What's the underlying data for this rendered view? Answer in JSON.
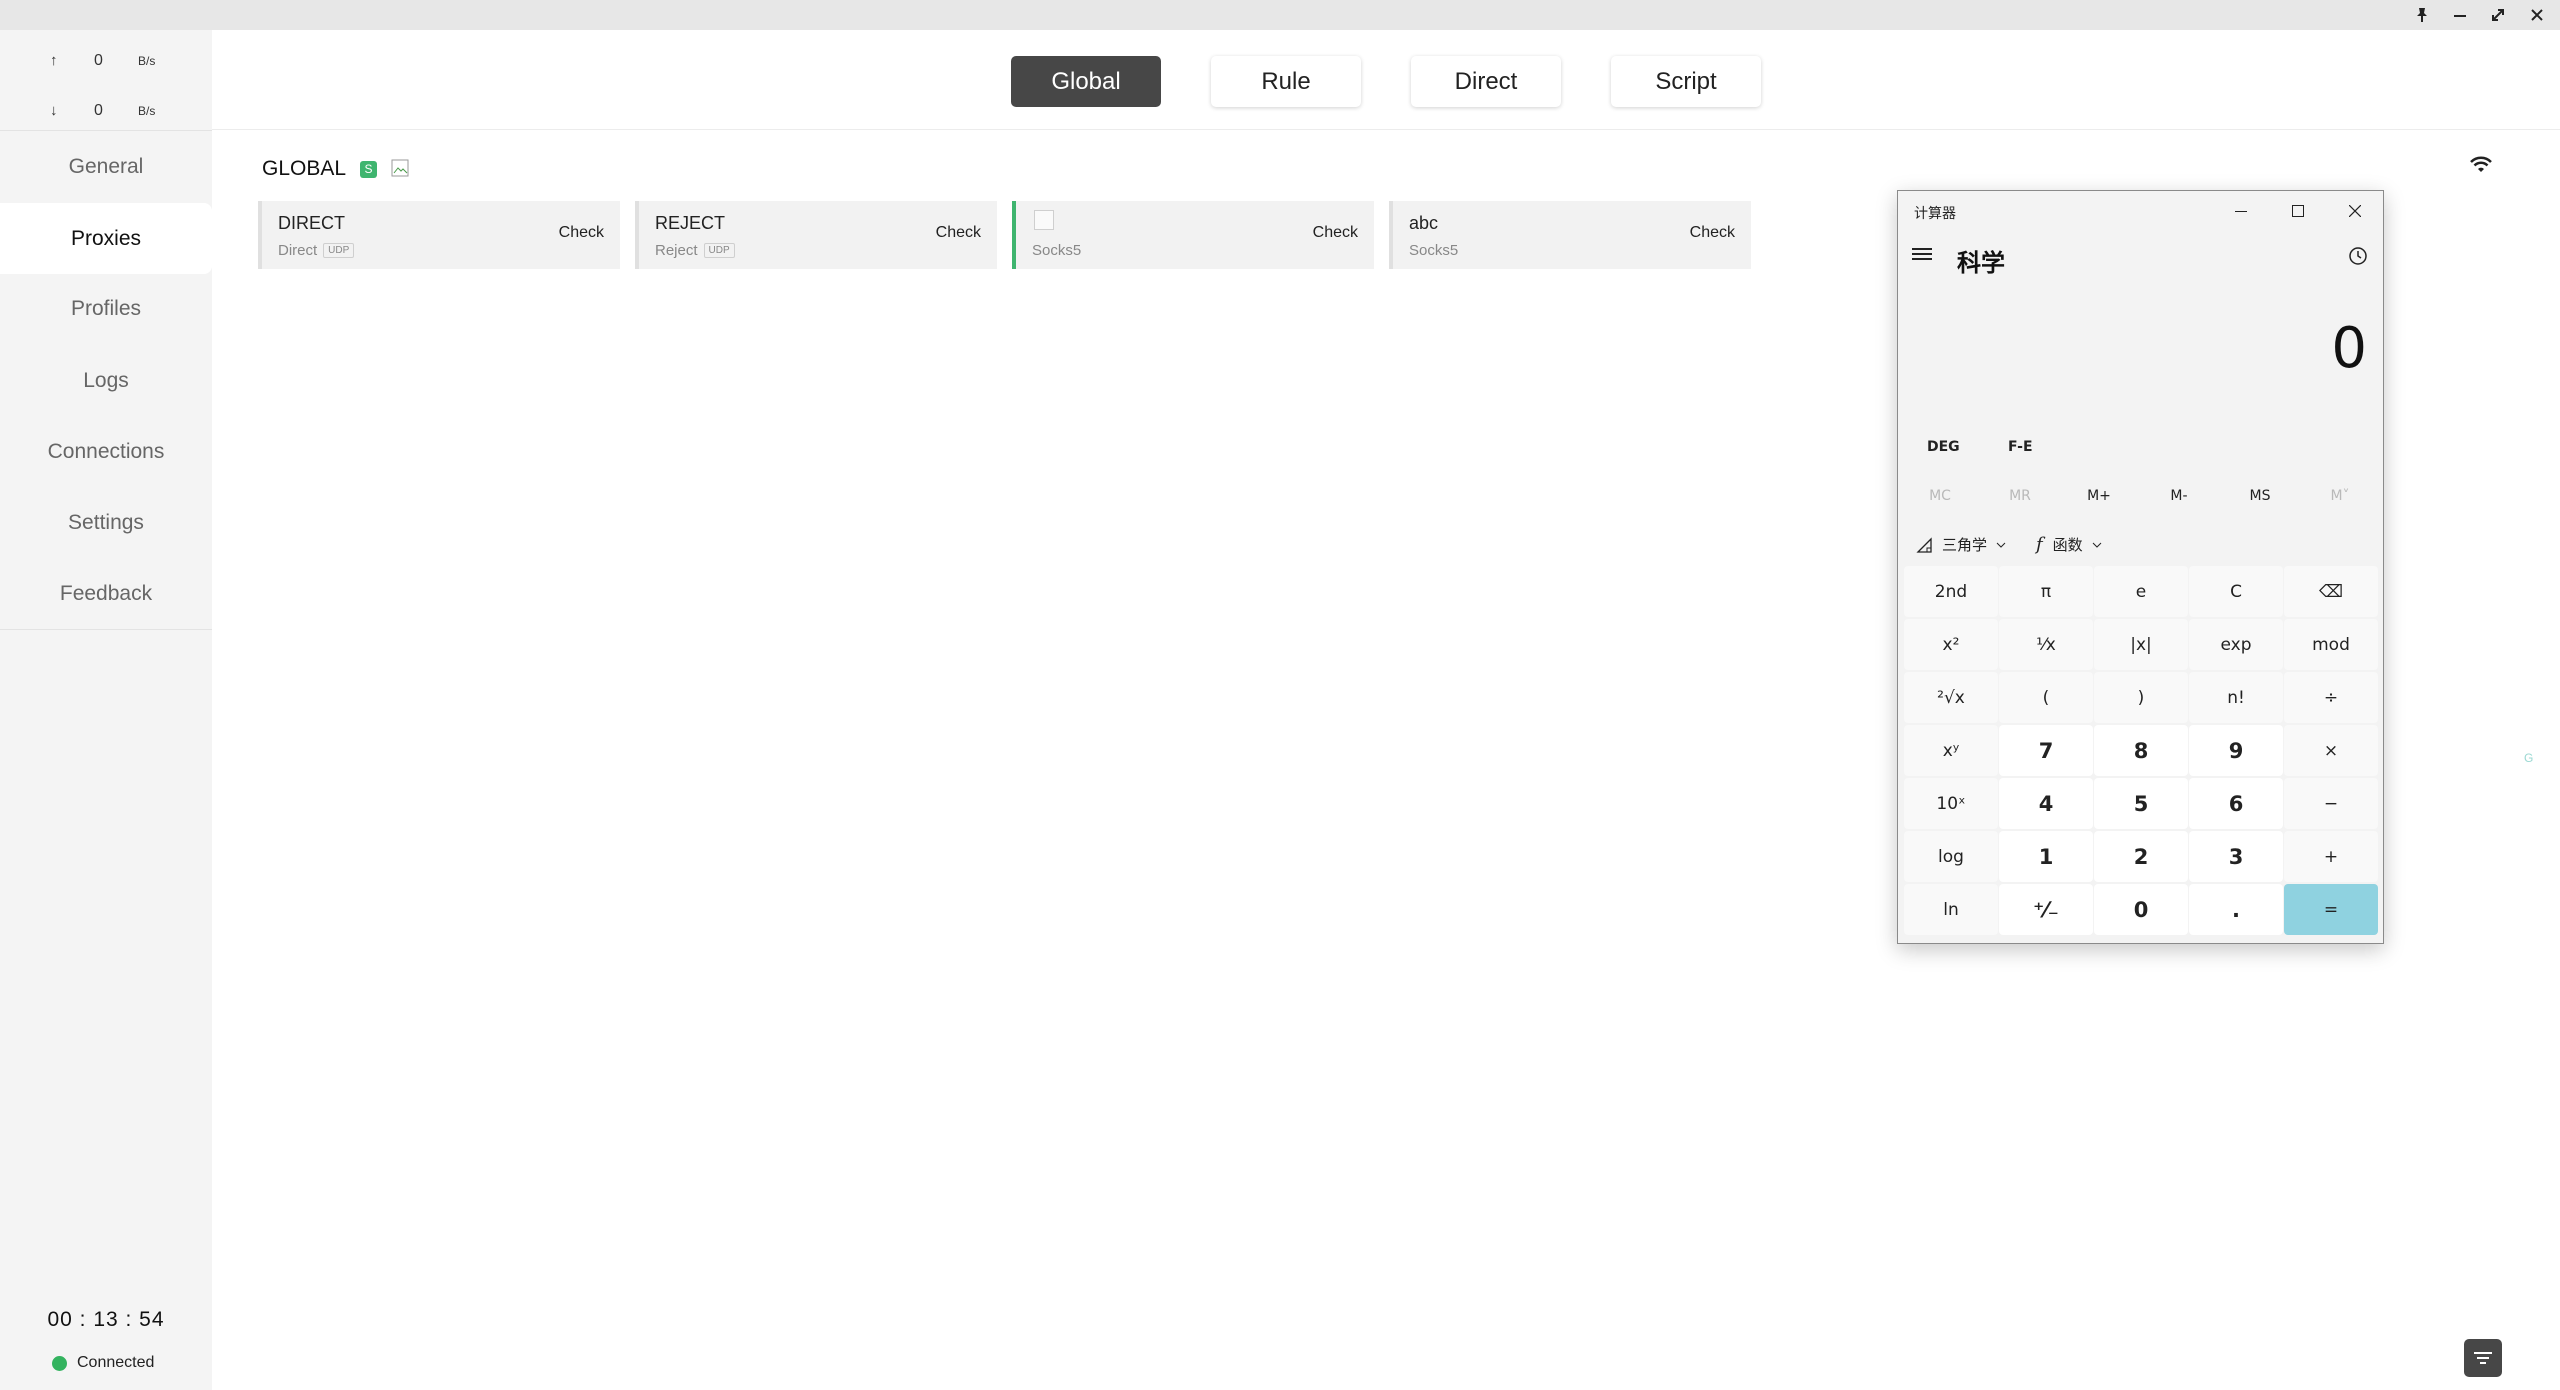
{
  "window_controls": {
    "pin_icon": "pin-icon",
    "minimize_icon": "minimize-icon",
    "maximize_icon": "maximize-icon",
    "close_icon": "close-icon"
  },
  "sidebar": {
    "traffic": {
      "up": {
        "arrow": "↑",
        "value": "0",
        "unit": "B/s"
      },
      "down": {
        "arrow": "↓",
        "value": "0",
        "unit": "B/s"
      }
    },
    "items": [
      {
        "label": "General"
      },
      {
        "label": "Proxies",
        "active": true
      },
      {
        "label": "Profiles"
      },
      {
        "label": "Logs"
      },
      {
        "label": "Connections"
      },
      {
        "label": "Settings"
      },
      {
        "label": "Feedback"
      }
    ],
    "uptime": "00 : 13 : 54",
    "status": "Connected",
    "status_color": "#33b35f"
  },
  "header": {
    "modes": [
      {
        "label": "Global",
        "active": true
      },
      {
        "label": "Rule"
      },
      {
        "label": "Direct"
      },
      {
        "label": "Script"
      }
    ]
  },
  "main": {
    "group": {
      "title": "GLOBAL",
      "badge": "S"
    },
    "proxies": [
      {
        "name": "DIRECT",
        "type": "Direct",
        "udp": "UDP",
        "check": "Check"
      },
      {
        "name": "REJECT",
        "type": "Reject",
        "udp": "UDP",
        "check": "Check"
      },
      {
        "name": "",
        "type": "Socks5",
        "check": "Check",
        "selected": true
      },
      {
        "name": "abc",
        "type": "Socks5",
        "check": "Check"
      }
    ],
    "side_letter": "G"
  },
  "calculator": {
    "title": "计算器",
    "mode": "科学",
    "display": "0",
    "options": [
      "DEG",
      "F-E"
    ],
    "memory": [
      {
        "label": "MC",
        "enabled": false
      },
      {
        "label": "MR",
        "enabled": false
      },
      {
        "label": "M+",
        "enabled": true
      },
      {
        "label": "M-",
        "enabled": true
      },
      {
        "label": "MS",
        "enabled": true
      },
      {
        "label": "M˅",
        "enabled": false
      }
    ],
    "dropdowns": [
      "三角学",
      "函数"
    ],
    "keys": [
      [
        "2nd",
        "π",
        "e",
        "C",
        "⌫"
      ],
      [
        "x²",
        "¹⁄x",
        "|x|",
        "exp",
        "mod"
      ],
      [
        "²√x",
        "(",
        ")",
        "n!",
        "÷"
      ],
      [
        "xʸ",
        "7",
        "8",
        "9",
        "×"
      ],
      [
        "10ˣ",
        "4",
        "5",
        "6",
        "−"
      ],
      [
        "log",
        "1",
        "2",
        "3",
        "+"
      ],
      [
        "ln",
        "⁺⁄₋",
        "0",
        ".",
        "="
      ]
    ],
    "accent": "#8fd2e0"
  }
}
